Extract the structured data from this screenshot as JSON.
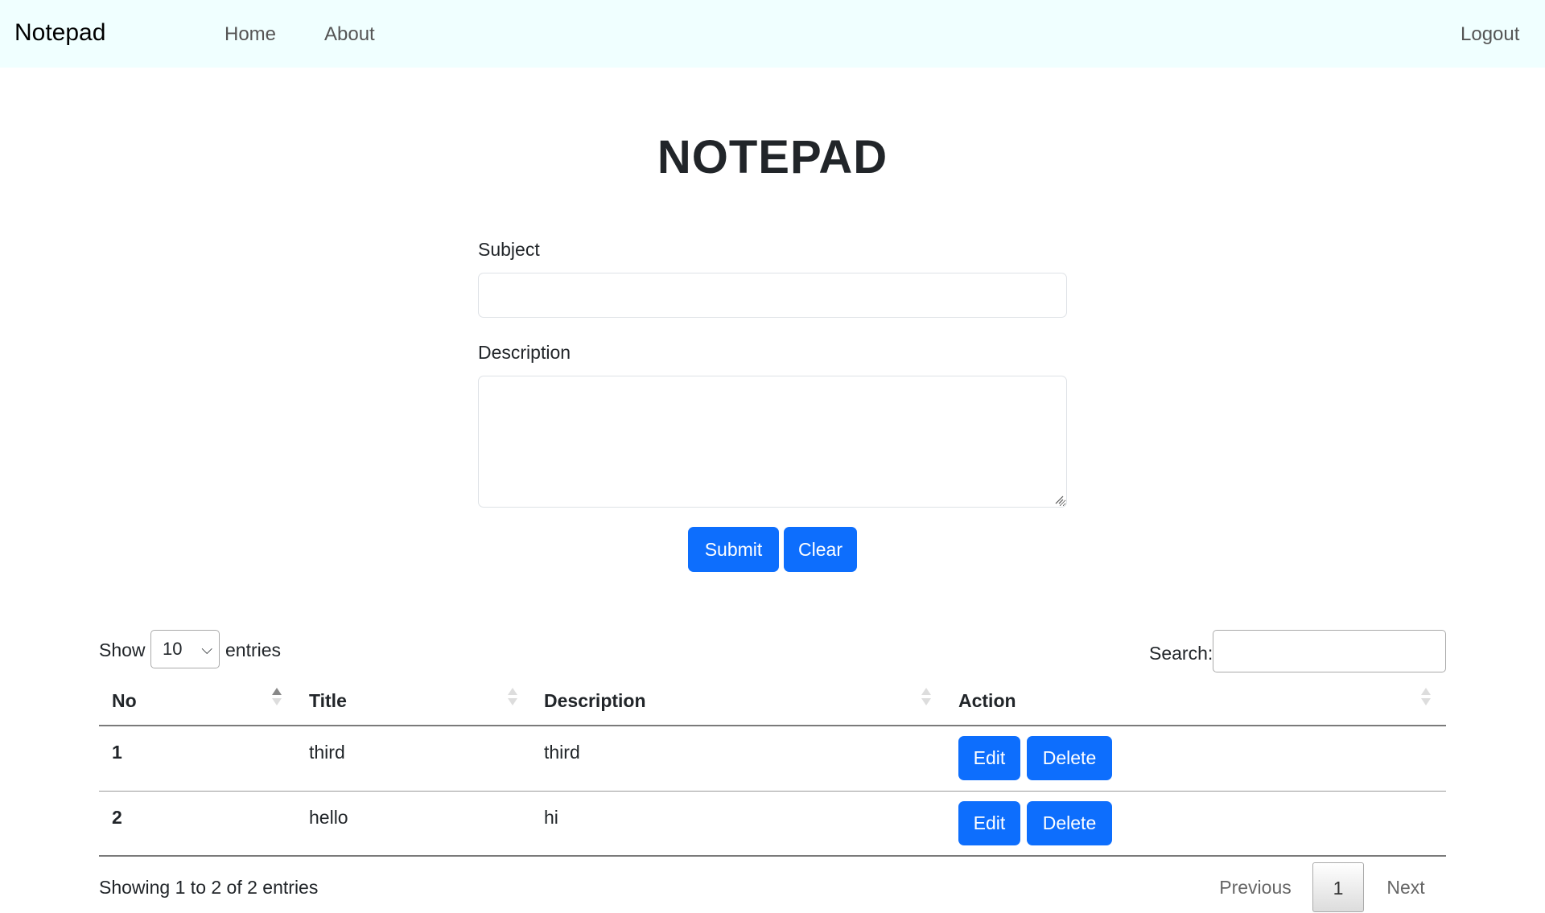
{
  "navbar": {
    "brand": "Notepad",
    "links": [
      "Home",
      "About"
    ],
    "logout": "Logout"
  },
  "page": {
    "title": "NOTEPAD"
  },
  "form": {
    "subject_label": "Subject",
    "subject_value": "",
    "description_label": "Description",
    "description_value": "",
    "submit_label": "Submit",
    "clear_label": "Clear"
  },
  "table_controls": {
    "show_label": "Show",
    "entries_value": "10",
    "entries_label": "entries",
    "search_label": "Search:",
    "search_value": ""
  },
  "table": {
    "columns": [
      "No",
      "Title",
      "Description",
      "Action"
    ],
    "rows": [
      {
        "no": "1",
        "title": "third",
        "description": "third",
        "edit": "Edit",
        "delete": "Delete"
      },
      {
        "no": "2",
        "title": "hello",
        "description": "hi",
        "edit": "Edit",
        "delete": "Delete"
      }
    ]
  },
  "footer": {
    "info": "Showing 1 to 2 of 2 entries",
    "previous": "Previous",
    "current_page": "1",
    "next": "Next"
  },
  "colors": {
    "navbar_bg": "#f0ffff",
    "primary": "#0d6efd"
  },
  "icons": [
    "sort-asc-icon",
    "sort-icon",
    "chevron-down-icon",
    "resize-grip-icon"
  ]
}
